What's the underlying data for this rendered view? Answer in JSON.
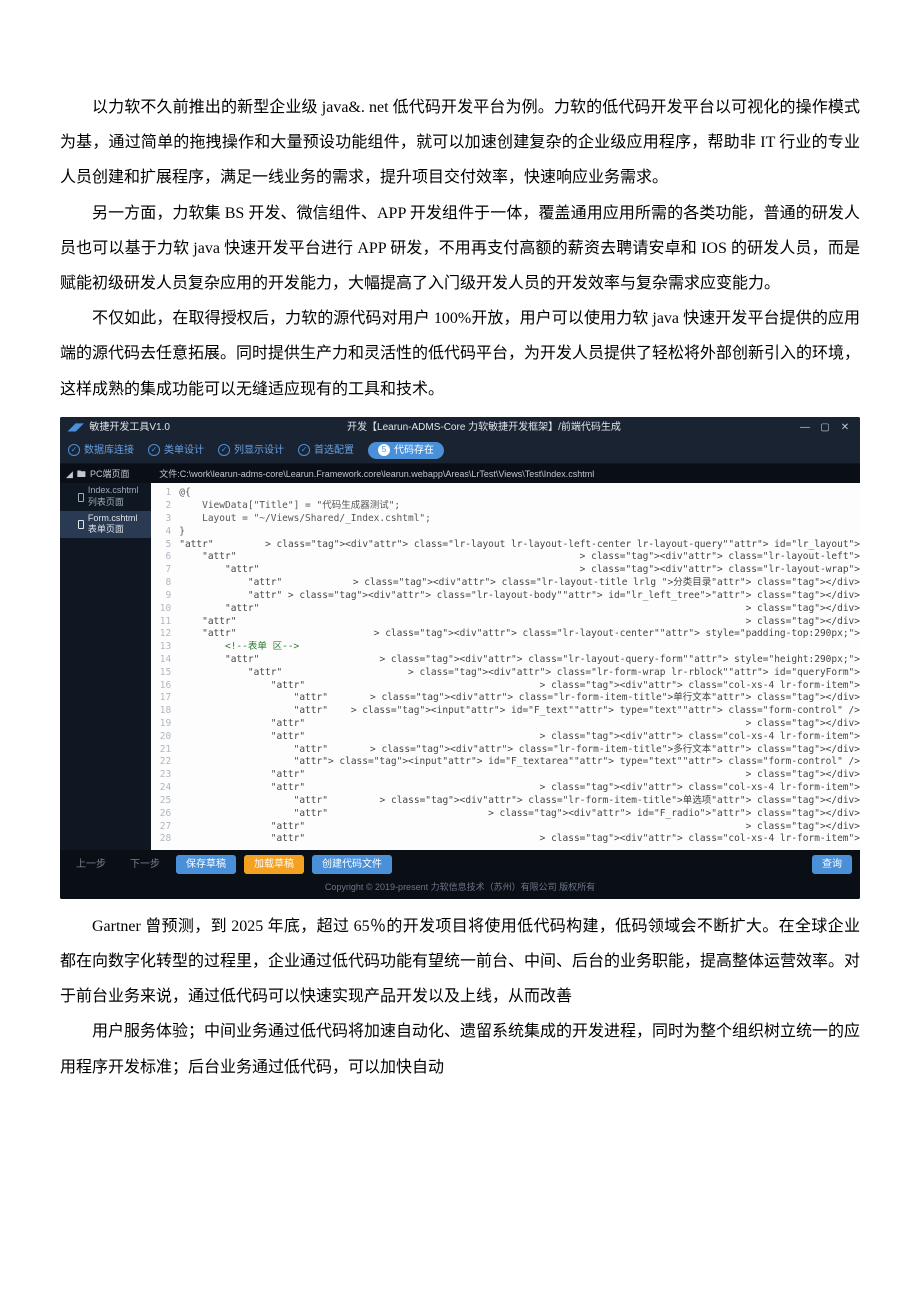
{
  "paragraphs": {
    "p1": "以力软不久前推出的新型企业级 java&. net 低代码开发平台为例。力软的低代码开发平台以可视化的操作模式为基，通过简单的拖拽操作和大量预设功能组件，就可以加速创建复杂的企业级应用程序，帮助非 IT 行业的专业人员创建和扩展程序，满足一线业务的需求，提升项目交付效率，快速响应业务需求。",
    "p2": "另一方面，力软集 BS 开发、微信组件、APP 开发组件于一体，覆盖通用应用所需的各类功能，普通的研发人员也可以基于力软 java 快速开发平台进行 APP 研发，不用再支付高额的薪资去聘请安卓和 IOS 的研发人员，而是赋能初级研发人员复杂应用的开发能力，大幅提高了入门级开发人员的开发效率与复杂需求应变能力。",
    "p3": "不仅如此，在取得授权后，力软的源代码对用户 100%开放，用户可以使用力软 java 快速开发平台提供的应用端的源代码去任意拓展。同时提供生产力和灵活性的低代码平台，为开发人员提供了轻松将外部创新引入的环境，这样成熟的集成功能可以无缝适应现有的工具和技术。",
    "p4": "Gartner 曾预测，到 2025 年底，超过 65％的开发项目将使用低代码构建，低码领域会不断扩大。在全球企业都在向数字化转型的过程里，企业通过低代码功能有望统一前台、中间、后台的业务职能，提高整体运营效率。对于前台业务来说，通过低代码可以快速实现产品开发以及上线，从而改善",
    "p5": "用户服务体验；中间业务通过低代码将加速自动化、遗留系统集成的开发进程，同时为整个组织树立统一的应用程序开发标准；后台业务通过低代码，可以加快自动"
  },
  "ide": {
    "app_name": "敏捷开发工具V1.0",
    "title": "开发【Learun-ADMS-Core 力软敏捷开发框架】/前端代码生成",
    "steps": {
      "s1": "数据库连接",
      "s2": "类单设计",
      "s3": "列显示设计",
      "s4": "首选配置",
      "s5_num": "5",
      "s5": "代码存在"
    },
    "sidebar": {
      "root": "PC端页面",
      "file1": "Index.cshtml 列表页面",
      "file2": "Form.cshtml 表单页面"
    },
    "path": "文件:C:\\work\\learun-adms-core\\Learun.Framework.core\\learun.webapp\\Areas\\LrTest\\Views\\Test\\Index.cshtml",
    "code": [
      {
        "n": "1",
        "t": "@{",
        "cls": "txt"
      },
      {
        "n": "2",
        "t": "    ViewData[\"Title\"] = \"代码生成器测试\";",
        "cls": "txt"
      },
      {
        "n": "3",
        "t": "    Layout = \"~/Views/Shared/_Index.cshtml\";",
        "cls": "txt"
      },
      {
        "n": "4",
        "t": "}",
        "cls": "txt"
      },
      {
        "n": "5",
        "t": "<div class=\"lr-layout lr-layout-left-center lr-layout-query\" id=\"lr_layout\">",
        "cls": "tag"
      },
      {
        "n": "6",
        "t": "    <div class=\"lr-layout-left\">",
        "cls": "tag"
      },
      {
        "n": "7",
        "t": "        <div class=\"lr-layout-wrap\">",
        "cls": "tag"
      },
      {
        "n": "8",
        "t": "            <div class=\"lr-layout-title lrlg \">分类目录</div>",
        "cls": "tag"
      },
      {
        "n": "9",
        "t": "            <div class=\"lr-layout-body\" id=\"lr_left_tree\"></div>",
        "cls": "tag"
      },
      {
        "n": "10",
        "t": "        </div>",
        "cls": "tag"
      },
      {
        "n": "11",
        "t": "    </div>",
        "cls": "tag"
      },
      {
        "n": "12",
        "t": "    <div class=\"lr-layout-center\" style=\"padding-top:290px;\">",
        "cls": "tag"
      },
      {
        "n": "13",
        "t": "        <!--表单 区-->",
        "cls": "cmt"
      },
      {
        "n": "14",
        "t": "        <div class=\"lr-layout-query-form\" style=\"height:290px;\">",
        "cls": "tag"
      },
      {
        "n": "15",
        "t": "            <div class=\"lr-form-wrap lr-rblock\" id=\"queryForm\">",
        "cls": "tag"
      },
      {
        "n": "16",
        "t": "                <div class=\"col-xs-4 lr-form-item\">",
        "cls": "tag"
      },
      {
        "n": "17",
        "t": "                    <div class=\"lr-form-item-title\">单行文本</div>",
        "cls": "tag"
      },
      {
        "n": "18",
        "t": "                    <input id=\"F_text\" type=\"text\" class=\"form-control\" />",
        "cls": "tag"
      },
      {
        "n": "19",
        "t": "                </div>",
        "cls": "tag"
      },
      {
        "n": "20",
        "t": "                <div class=\"col-xs-4 lr-form-item\">",
        "cls": "tag"
      },
      {
        "n": "21",
        "t": "                    <div class=\"lr-form-item-title\">多行文本</div>",
        "cls": "tag"
      },
      {
        "n": "22",
        "t": "                    <input id=\"F_textarea\" type=\"text\" class=\"form-control\" />",
        "cls": "tag"
      },
      {
        "n": "23",
        "t": "                </div>",
        "cls": "tag"
      },
      {
        "n": "24",
        "t": "                <div class=\"col-xs-4 lr-form-item\">",
        "cls": "tag"
      },
      {
        "n": "25",
        "t": "                    <div class=\"lr-form-item-title\">单选项</div>",
        "cls": "tag"
      },
      {
        "n": "26",
        "t": "                    <div id=\"F_radio\"></div>",
        "cls": "tag"
      },
      {
        "n": "27",
        "t": "                </div>",
        "cls": "tag"
      },
      {
        "n": "28",
        "t": "                <div class=\"col-xs-4 lr-form-item\">",
        "cls": "tag"
      }
    ],
    "bottom": {
      "prev": "上一步",
      "next": "下一步",
      "b1": "保存草稿",
      "b2": "加载草稿",
      "b3": "创建代码文件",
      "b4": "查询"
    },
    "copyright": "Copyright © 2019-present 力软信息技术（苏州）有限公司 版权所有"
  }
}
